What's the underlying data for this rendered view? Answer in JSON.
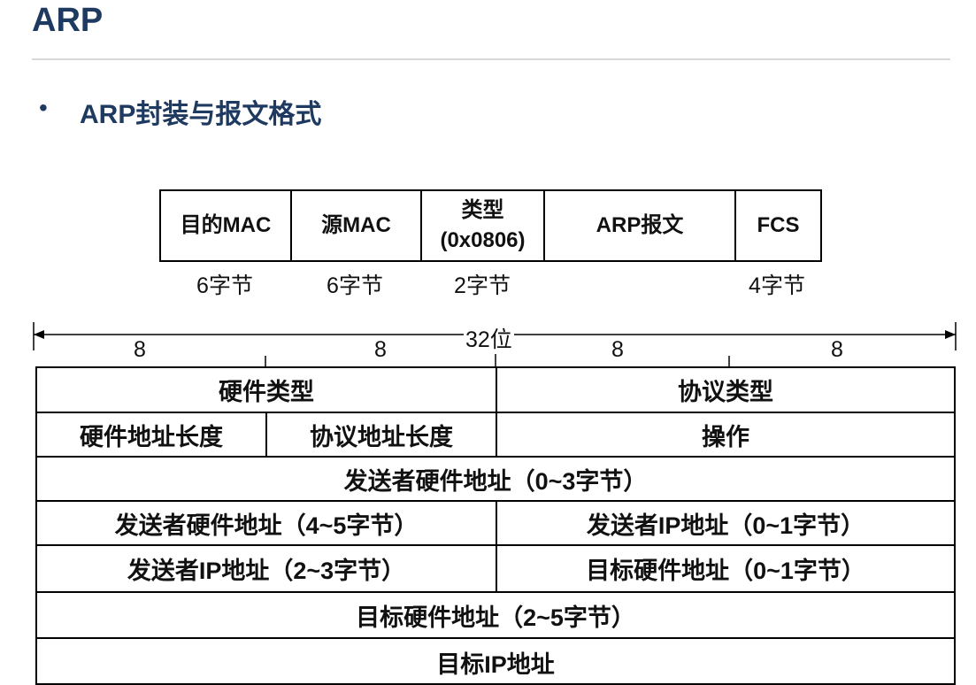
{
  "title": "ARP",
  "subtitle": "ARP封装与报文格式",
  "bullet": "•",
  "frame": {
    "fields": [
      "目的MAC",
      "源MAC",
      "类型\n(0x0806)",
      "ARP报文",
      "FCS"
    ],
    "sizes": [
      "6字节",
      "6字节",
      "2字节",
      "",
      "4字节"
    ]
  },
  "ruler": {
    "total": "32位",
    "bytes": [
      "8",
      "8",
      "8",
      "8"
    ]
  },
  "table": {
    "rows": [
      [
        "硬件类型",
        "协议类型"
      ],
      [
        "硬件地址长度",
        "协议地址长度",
        "操作"
      ],
      [
        "发送者硬件地址（0~3字节）"
      ],
      [
        "发送者硬件地址（4~5字节）",
        "发送者IP地址（0~1字节）"
      ],
      [
        "发送者IP地址（2~3字节）",
        "目标硬件地址（0~1字节）"
      ],
      [
        "目标硬件地址（2~5字节）"
      ],
      [
        "目标IP地址"
      ]
    ]
  }
}
